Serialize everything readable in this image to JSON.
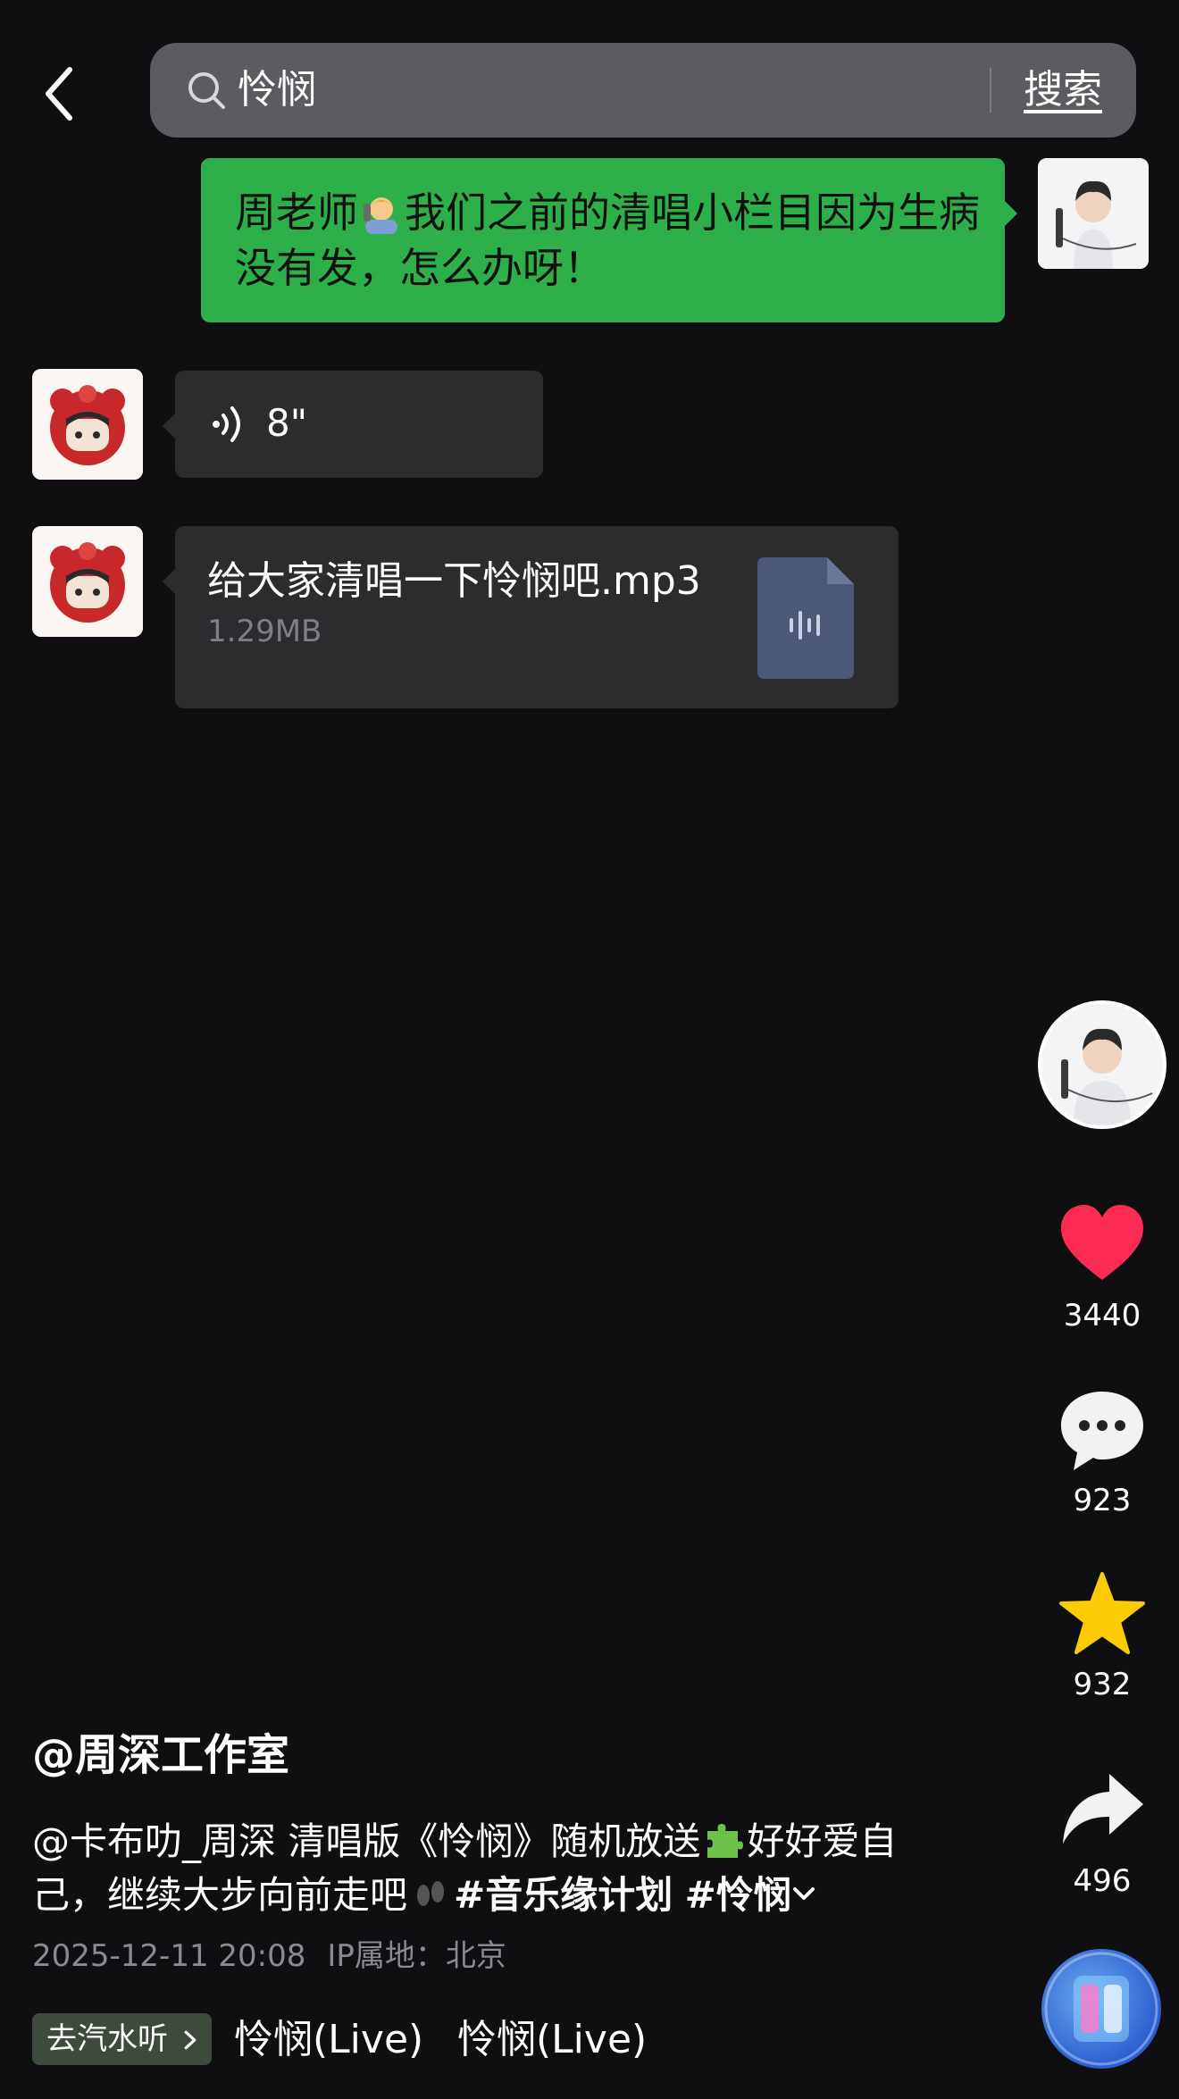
{
  "header": {
    "search_query": "怜悯",
    "search_button": "搜索"
  },
  "chat": {
    "outgoing_message_before_emoji": "周老师",
    "outgoing_message_after_emoji": "我们之前的清唱小栏目因为生病没有发，怎么办呀！",
    "voice_duration": "8\"",
    "file_name": "给大家清唱一下怜悯吧.mp3",
    "file_size": "1.29MB"
  },
  "rail": {
    "likes": "3440",
    "comments": "923",
    "favorites": "932",
    "shares": "496"
  },
  "post": {
    "author": "@周深工作室",
    "caption_part1": "@卡布叻_周深 清唱版《怜悯》随机放送",
    "caption_part2": "好好爱自己，继续大步向前走吧",
    "hashtag1": "#音乐缘计划",
    "hashtag2": "#怜悯",
    "date": "2025-12-11 20:08",
    "ip_location": "IP属地：北京",
    "soda_button": "去汽水听",
    "song_1": "怜悯(Live)",
    "song_2": "怜悯(Live)"
  },
  "colors": {
    "background": "#0f0f11",
    "outgoing_bubble": "#2db04a",
    "incoming_bubble": "#2c2c2e",
    "like": "#fe2c55",
    "favorite": "#fdcb04"
  },
  "icons": [
    "back-arrow-icon",
    "search-icon",
    "voice-wave-icon",
    "audio-file-icon",
    "heart-icon",
    "comment-icon",
    "star-icon",
    "share-icon",
    "chevron-down-icon",
    "chevron-right-icon"
  ]
}
